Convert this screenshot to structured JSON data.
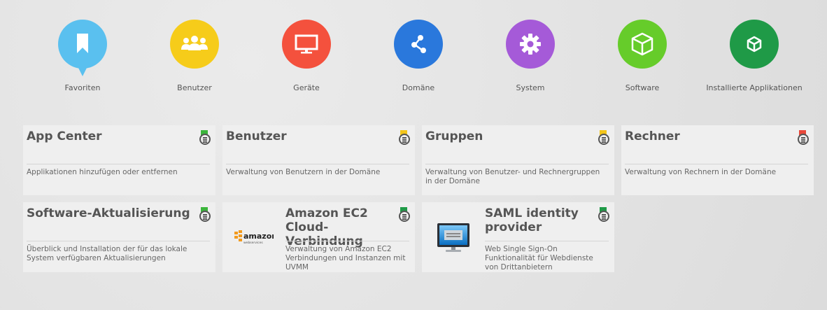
{
  "categories": [
    {
      "label": "Favoriten",
      "color": "#5ac0ef",
      "icon": "bookmark-icon"
    },
    {
      "label": "Benutzer",
      "color": "#f6cc1a",
      "icon": "users-icon"
    },
    {
      "label": "Geräte",
      "color": "#f4513d",
      "icon": "monitor-icon"
    },
    {
      "label": "Domäne",
      "color": "#2a78dc",
      "icon": "share-icon"
    },
    {
      "label": "System",
      "color": "#a55ad8",
      "icon": "gear-icon"
    },
    {
      "label": "Software",
      "color": "#66cc2a",
      "icon": "box-icon"
    },
    {
      "label": "Installierte Applikationen",
      "color": "#1f9a47",
      "icon": "cube-icon"
    }
  ],
  "tiles": [
    {
      "title": "App Center",
      "desc": "Applikationen hinzufügen oder entfernen",
      "flag": "#3bb53b"
    },
    {
      "title": "Benutzer",
      "desc": "Verwaltung von Benutzern in der Domäne",
      "flag": "#f3c51a"
    },
    {
      "title": "Gruppen",
      "desc": "Verwaltung von Benutzer- und Rechnergruppen in der Domäne",
      "flag": "#f3c51a"
    },
    {
      "title": "Rechner",
      "desc": "Verwaltung von Rechnern in der Domäne",
      "flag": "#e8483a"
    },
    {
      "title": "Software-Aktualisierung",
      "desc": "Überblick und Installation der für das lokale System verfügbaren Aktualisierungen",
      "flag": "#3bb53b"
    },
    {
      "title": "Amazon EC2 Cloud-Verbindung",
      "desc": "Verwaltung von Amazon EC2 Verbindungen und Instanzen mit UVMM",
      "flag": "#1f9a47",
      "logo_text": "amazon",
      "logo_sub": "webservices"
    },
    {
      "title": "SAML identity provider",
      "desc": "Web Single Sign-On Funktionalität für Webdienste von Drittanbietern",
      "flag": "#1f9a47"
    }
  ]
}
